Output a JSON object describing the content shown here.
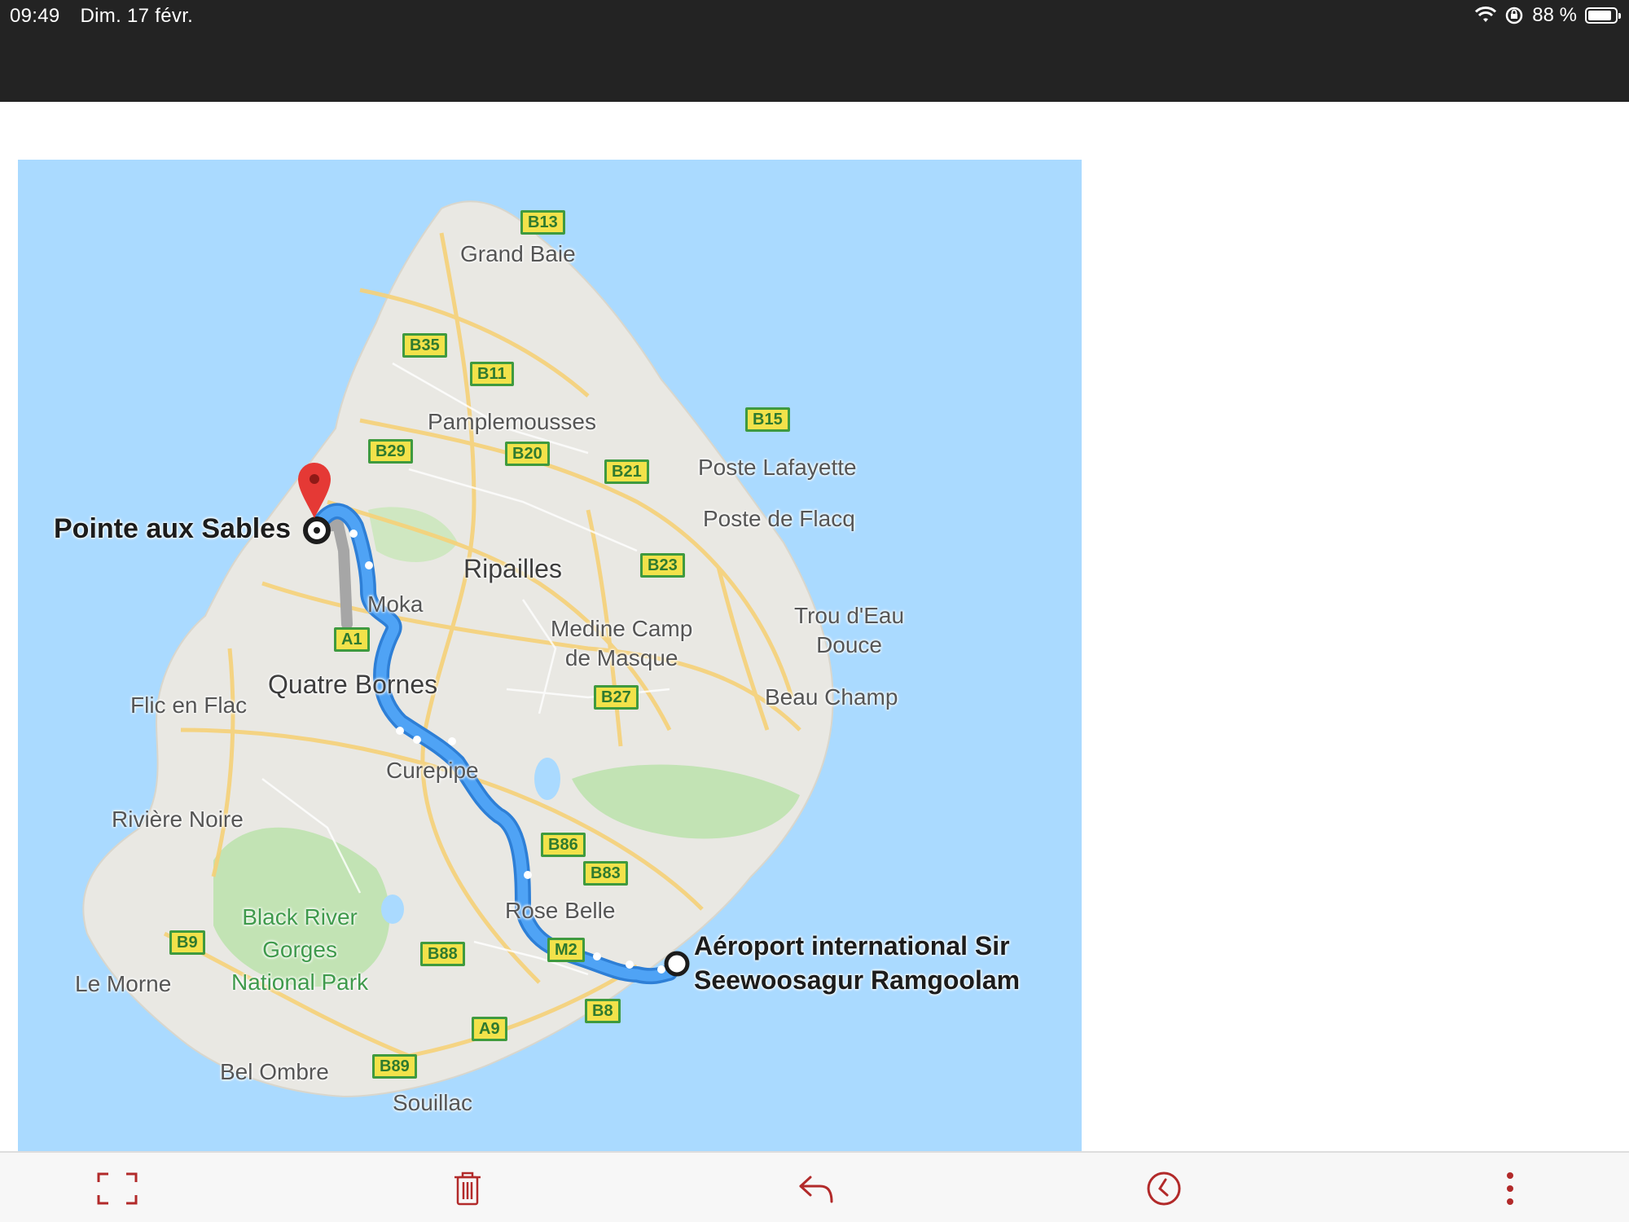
{
  "status_bar": {
    "time": "09:49",
    "date": "Dim. 17 févr.",
    "battery_percent": "88 %",
    "battery_level": 0.88,
    "icons": [
      "wifi-icon",
      "orientation-lock-icon",
      "battery-icon"
    ]
  },
  "map": {
    "destination": "Pointe aux Sables",
    "origin_line1": "Aéroport international Sir",
    "origin_line2": "Seewoosagur Ramgoolam",
    "places": {
      "grand_baie": "Grand Baie",
      "pamplemousses": "Pamplemousses",
      "poste_lafayette": "Poste Lafayette",
      "poste_de_flacq": "Poste de Flacq",
      "ripailles": "Ripailles",
      "moka": "Moka",
      "medine_1": "Medine Camp",
      "medine_2": "de Masque",
      "trou_1": "Trou d'Eau",
      "trou_2": "Douce",
      "quatre_bornes": "Quatre Bornes",
      "flic_en_flac": "Flic en Flac",
      "beau_champ": "Beau Champ",
      "curepipe": "Curepipe",
      "riviere_noire": "Rivière Noire",
      "rose_belle": "Rose Belle",
      "park_1": "Black River",
      "park_2": "Gorges",
      "park_3": "National Park",
      "le_morne": "Le Morne",
      "bel_ombre": "Bel Ombre",
      "souillac": "Souillac"
    },
    "roads": {
      "b13": "B13",
      "b35": "B35",
      "b11": "B11",
      "b15": "B15",
      "b29": "B29",
      "b20": "B20",
      "b21": "B21",
      "b23": "B23",
      "a1": "A1",
      "b27": "B27",
      "b86": "B86",
      "b83": "B83",
      "b9": "B9",
      "b88": "B88",
      "m2": "M2",
      "b8": "B8",
      "a9": "A9",
      "b89": "B89"
    },
    "colors": {
      "water": "#aadaff",
      "land": "#e9e8e3",
      "park": "#c2e3b4",
      "route": "#4a9ff0",
      "route_outline": "#2e7fd6",
      "alt_route": "#a6a6a6",
      "pin": "#e53935"
    }
  },
  "toolbar": {
    "buttons": [
      "fullscreen-icon",
      "trash-icon",
      "reply-icon",
      "clock-icon",
      "more-vertical-icon"
    ],
    "accent": "#b22a2a"
  }
}
